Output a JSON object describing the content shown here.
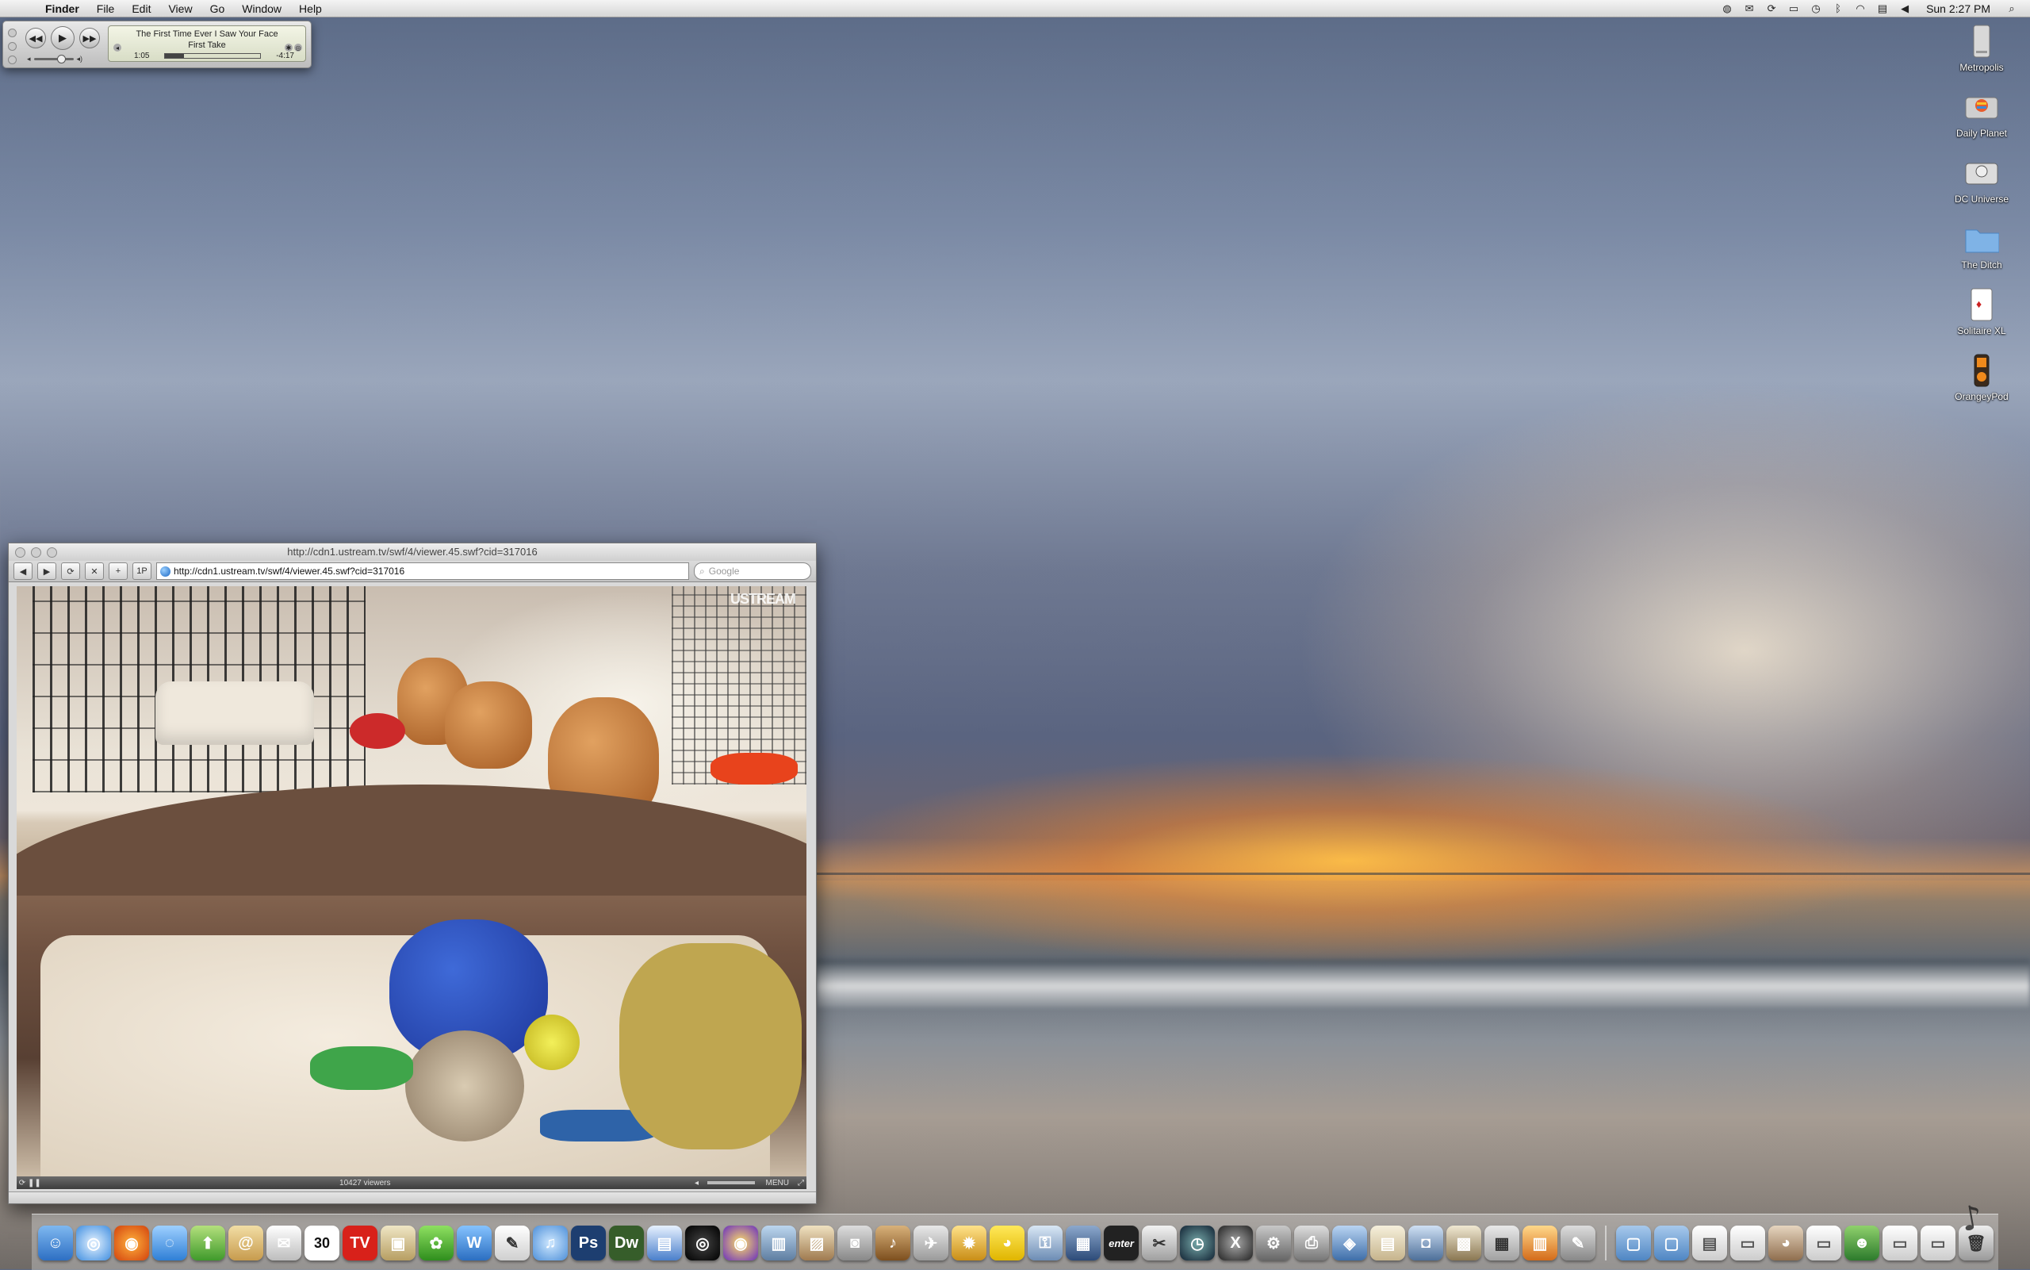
{
  "menubar": {
    "app": "Finder",
    "menus": [
      "File",
      "Edit",
      "View",
      "Go",
      "Window",
      "Help"
    ],
    "clock": "Sun 2:27 PM"
  },
  "mini_player": {
    "track": "The First Time Ever I Saw Your Face",
    "album": "First Take",
    "elapsed": "1:05",
    "remaining": "-4:17",
    "progress_fraction": 0.2,
    "volume_fraction": 0.7
  },
  "desktop": {
    "icons": [
      {
        "label": "Metropolis",
        "icon": "hard-drive-icon"
      },
      {
        "label": "Daily Planet",
        "icon": "apple-drive-icon"
      },
      {
        "label": "DC Universe",
        "icon": "drive-icon"
      },
      {
        "label": "The Ditch",
        "icon": "folder-icon"
      },
      {
        "label": "Solitaire XL",
        "icon": "cards-icon"
      },
      {
        "label": "OrangeyPod",
        "icon": "ipod-icon"
      }
    ]
  },
  "browser": {
    "title": "http://cdn1.ustream.tv/swf/4/viewer.45.swf?cid=317016",
    "url": "http://cdn1.ustream.tv/swf/4/viewer.45.swf?cid=317016",
    "search_placeholder": "Google",
    "video": {
      "brand": "USTREAM",
      "viewers": "10427 viewers",
      "menu_label": "MENU"
    }
  },
  "dock": {
    "calendar_day": "30",
    "enter_label": "enter",
    "ps_label": "Ps",
    "dw_label": "Dw"
  }
}
